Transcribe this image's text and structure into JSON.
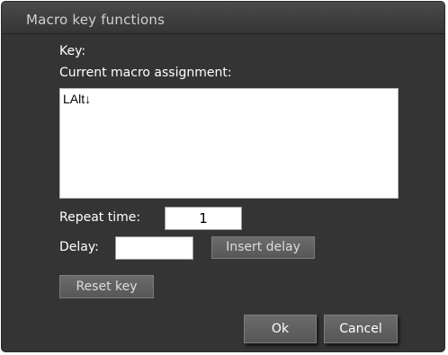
{
  "dialog": {
    "title": "Macro key functions"
  },
  "labels": {
    "key": "Key:",
    "current_assignment": "Current macro assignment:",
    "repeat_time": "Repeat time:",
    "delay": "Delay:"
  },
  "macro": {
    "assignment_text": "LAlt↓"
  },
  "fields": {
    "repeat_time_value": "1",
    "delay_value": ""
  },
  "buttons": {
    "insert_delay": "Insert delay",
    "reset_key": "Reset key",
    "ok": "Ok",
    "cancel": "Cancel"
  }
}
